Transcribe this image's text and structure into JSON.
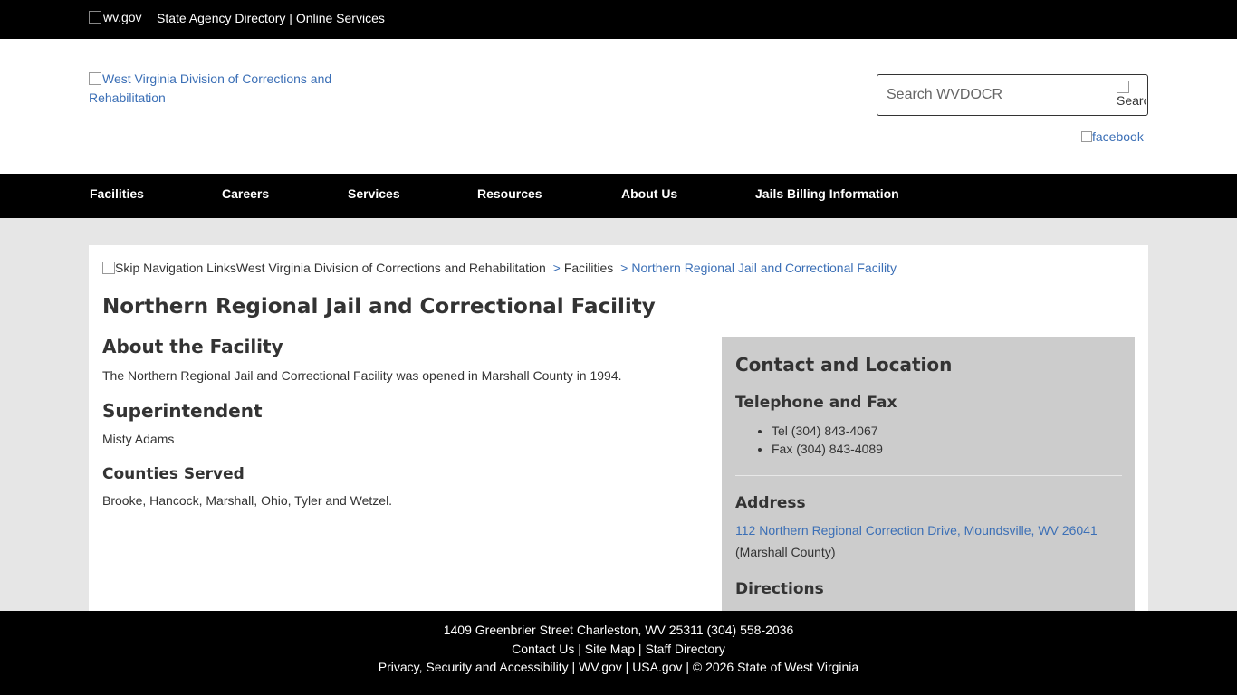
{
  "topbar": {
    "logo_alt": "wv.gov",
    "agency_directory": "State Agency Directory",
    "separator": "|",
    "online_services": "Online Services"
  },
  "header": {
    "site_logo_alt": "West Virginia Division of Corrections and Rehabilitation",
    "search_placeholder": "Search WVDOCR",
    "search_button_alt": "Search",
    "facebook_alt": "facebook"
  },
  "nav": {
    "items": [
      {
        "label": "Facilities"
      },
      {
        "label": "Careers"
      },
      {
        "label": "Services"
      },
      {
        "label": "Resources"
      },
      {
        "label": "About Us"
      },
      {
        "label": "Jails Billing Information"
      }
    ]
  },
  "breadcrumb": {
    "skip_alt": "Skip Navigation Links",
    "root": "West Virginia Division of Corrections and Rehabilitation",
    "sep": ">",
    "section": "Facilities",
    "current": "Northern Regional Jail and Correctional Facility"
  },
  "page": {
    "title": "Northern Regional Jail and Correctional Facility",
    "about_heading": "About the Facility",
    "about_text": "The Northern Regional Jail and Correctional Facility was opened in Marshall County in 1994.",
    "superintendent_heading": "Superintendent",
    "superintendent_name": "Misty Adams",
    "counties_heading": "Counties Served",
    "counties_text": "Brooke, Hancock, Marshall, Ohio, Tyler and Wetzel."
  },
  "sidebar": {
    "heading": "Contact and Location",
    "phone_heading": "Telephone and Fax",
    "tel": "Tel (304) 843-4067",
    "fax": "Fax (304) 843-4089",
    "address_heading": "Address",
    "address_link": "112 Northern Regional Correction Drive, Moundsville, WV 26041",
    "county": "(Marshall County)",
    "directions_heading": "Directions"
  },
  "footer": {
    "address_line": "1409 Greenbrier Street Charleston, WV 25311 (304) 558-2036",
    "contact_us": "Contact Us",
    "site_map": "Site Map",
    "staff_directory": "Staff Directory",
    "privacy": "Privacy, Security and Accessibility",
    "wvgov": "WV.gov",
    "usagov": "USA.gov",
    "copyright": "© 2026 State of West Virginia",
    "sep": "|"
  }
}
